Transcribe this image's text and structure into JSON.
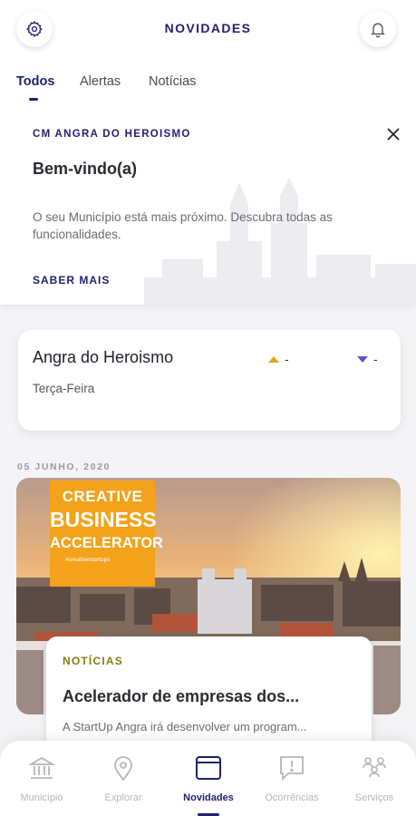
{
  "header": {
    "title": "NOVIDADES",
    "settings_icon": "gear-icon",
    "notifications_icon": "bell-icon"
  },
  "tabs": [
    {
      "label": "Todos",
      "active": true
    },
    {
      "label": "Alertas",
      "active": false
    },
    {
      "label": "Notícias",
      "active": false
    }
  ],
  "welcome": {
    "kicker": "CM ANGRA DO HEROISMO",
    "title": "Bem-vindo(a)",
    "text": "O seu Município está mais próximo. Descubra todas as funcionalidades.",
    "link": "SABER MAIS"
  },
  "weather": {
    "city": "Angra do Heroismo",
    "day": "Terça-Feira",
    "max": "-",
    "min": "-",
    "max_color": "#e6a21a",
    "min_color": "#6a4fc7"
  },
  "feed": {
    "date": "05 JUNHO, 2020",
    "promo": {
      "line1": "CREATIVE",
      "line2": "BUSINESS",
      "line3": "ACCELERATOR",
      "line4": "#creativestartups"
    },
    "card": {
      "kicker": "NOTÍCIAS",
      "title": "Acelerador de empresas dos...",
      "excerpt": "A StartUp Angra irá desenvolver um program..."
    }
  },
  "bottom_nav": [
    {
      "label": "Município",
      "icon": "building-icon",
      "active": false
    },
    {
      "label": "Explorar",
      "icon": "map-pin-icon",
      "active": false
    },
    {
      "label": "Novidades",
      "icon": "news-icon",
      "active": true
    },
    {
      "label": "Ocorrências",
      "icon": "alert-bubble-icon",
      "active": false
    },
    {
      "label": "Serviços",
      "icon": "services-icon",
      "active": false
    }
  ],
  "colors": {
    "primary": "#1f1f73",
    "accent": "#f4a21b"
  }
}
